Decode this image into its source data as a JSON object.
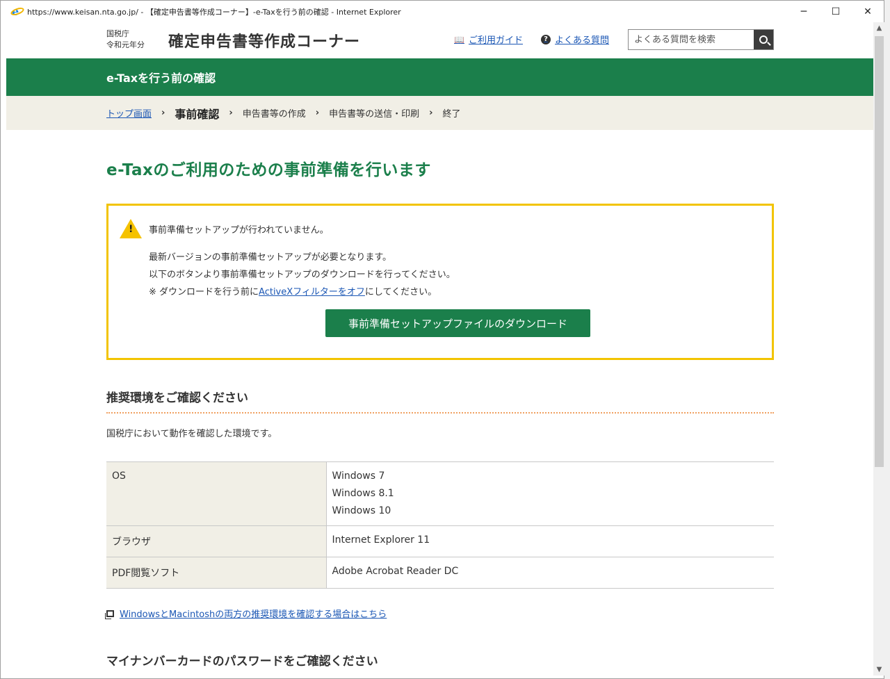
{
  "window": {
    "title": "https://www.keisan.nta.go.jp/ - 【確定申告書等作成コーナー】-e-Taxを行う前の確認 - Internet Explorer",
    "minimize": "─",
    "maximize": "☐",
    "close": "✕"
  },
  "header": {
    "agency_line1": "国税庁",
    "agency_line2": "令和元年分",
    "site_title": "確定申告書等作成コーナー",
    "guide_link": "ご利用ガイド",
    "faq_link": "よくある質問",
    "search_placeholder": "よくある質問を検索"
  },
  "page_bar": {
    "title": "e-Taxを行う前の確認"
  },
  "breadcrumb": {
    "items": [
      "トップ画面",
      "事前確認",
      "申告書等の作成",
      "申告書等の送信・印刷",
      "終了"
    ]
  },
  "main": {
    "title": "e-Taxのご利用のための事前準備を行います",
    "warning": {
      "headline": "事前準備セットアップが行われていません。",
      "line1": "最新バージョンの事前準備セットアップが必要となります。",
      "line2": "以下のボタンより事前準備セットアップのダウンロードを行ってください。",
      "line3_prefix": "※ ダウンロードを行う前に",
      "line3_link": "ActiveXフィルターをオフ",
      "line3_suffix": "にしてください。",
      "button": "事前準備セットアップファイルのダウンロード"
    },
    "env_section": {
      "title": "推奨環境をご確認ください",
      "desc": "国税庁において動作を確認した環境です。",
      "rows": [
        {
          "label": "OS",
          "values": [
            "Windows 7",
            "Windows 8.1",
            "Windows 10"
          ]
        },
        {
          "label": "ブラウザ",
          "values": [
            "Internet Explorer 11"
          ]
        },
        {
          "label": "PDF閲覧ソフト",
          "values": [
            "Adobe Acrobat Reader DC"
          ]
        }
      ],
      "link": "WindowsとMacintoshの両方の推奨環境を確認する場合はこちら"
    },
    "mynumber_section": {
      "title": "マイナンバーカードのパスワードをご確認ください"
    }
  },
  "colors": {
    "brand_green": "#1b7f4b",
    "warning_border": "#f2c400",
    "link_blue": "#1a56b4",
    "breadcrumb_bg": "#f1efe6"
  }
}
